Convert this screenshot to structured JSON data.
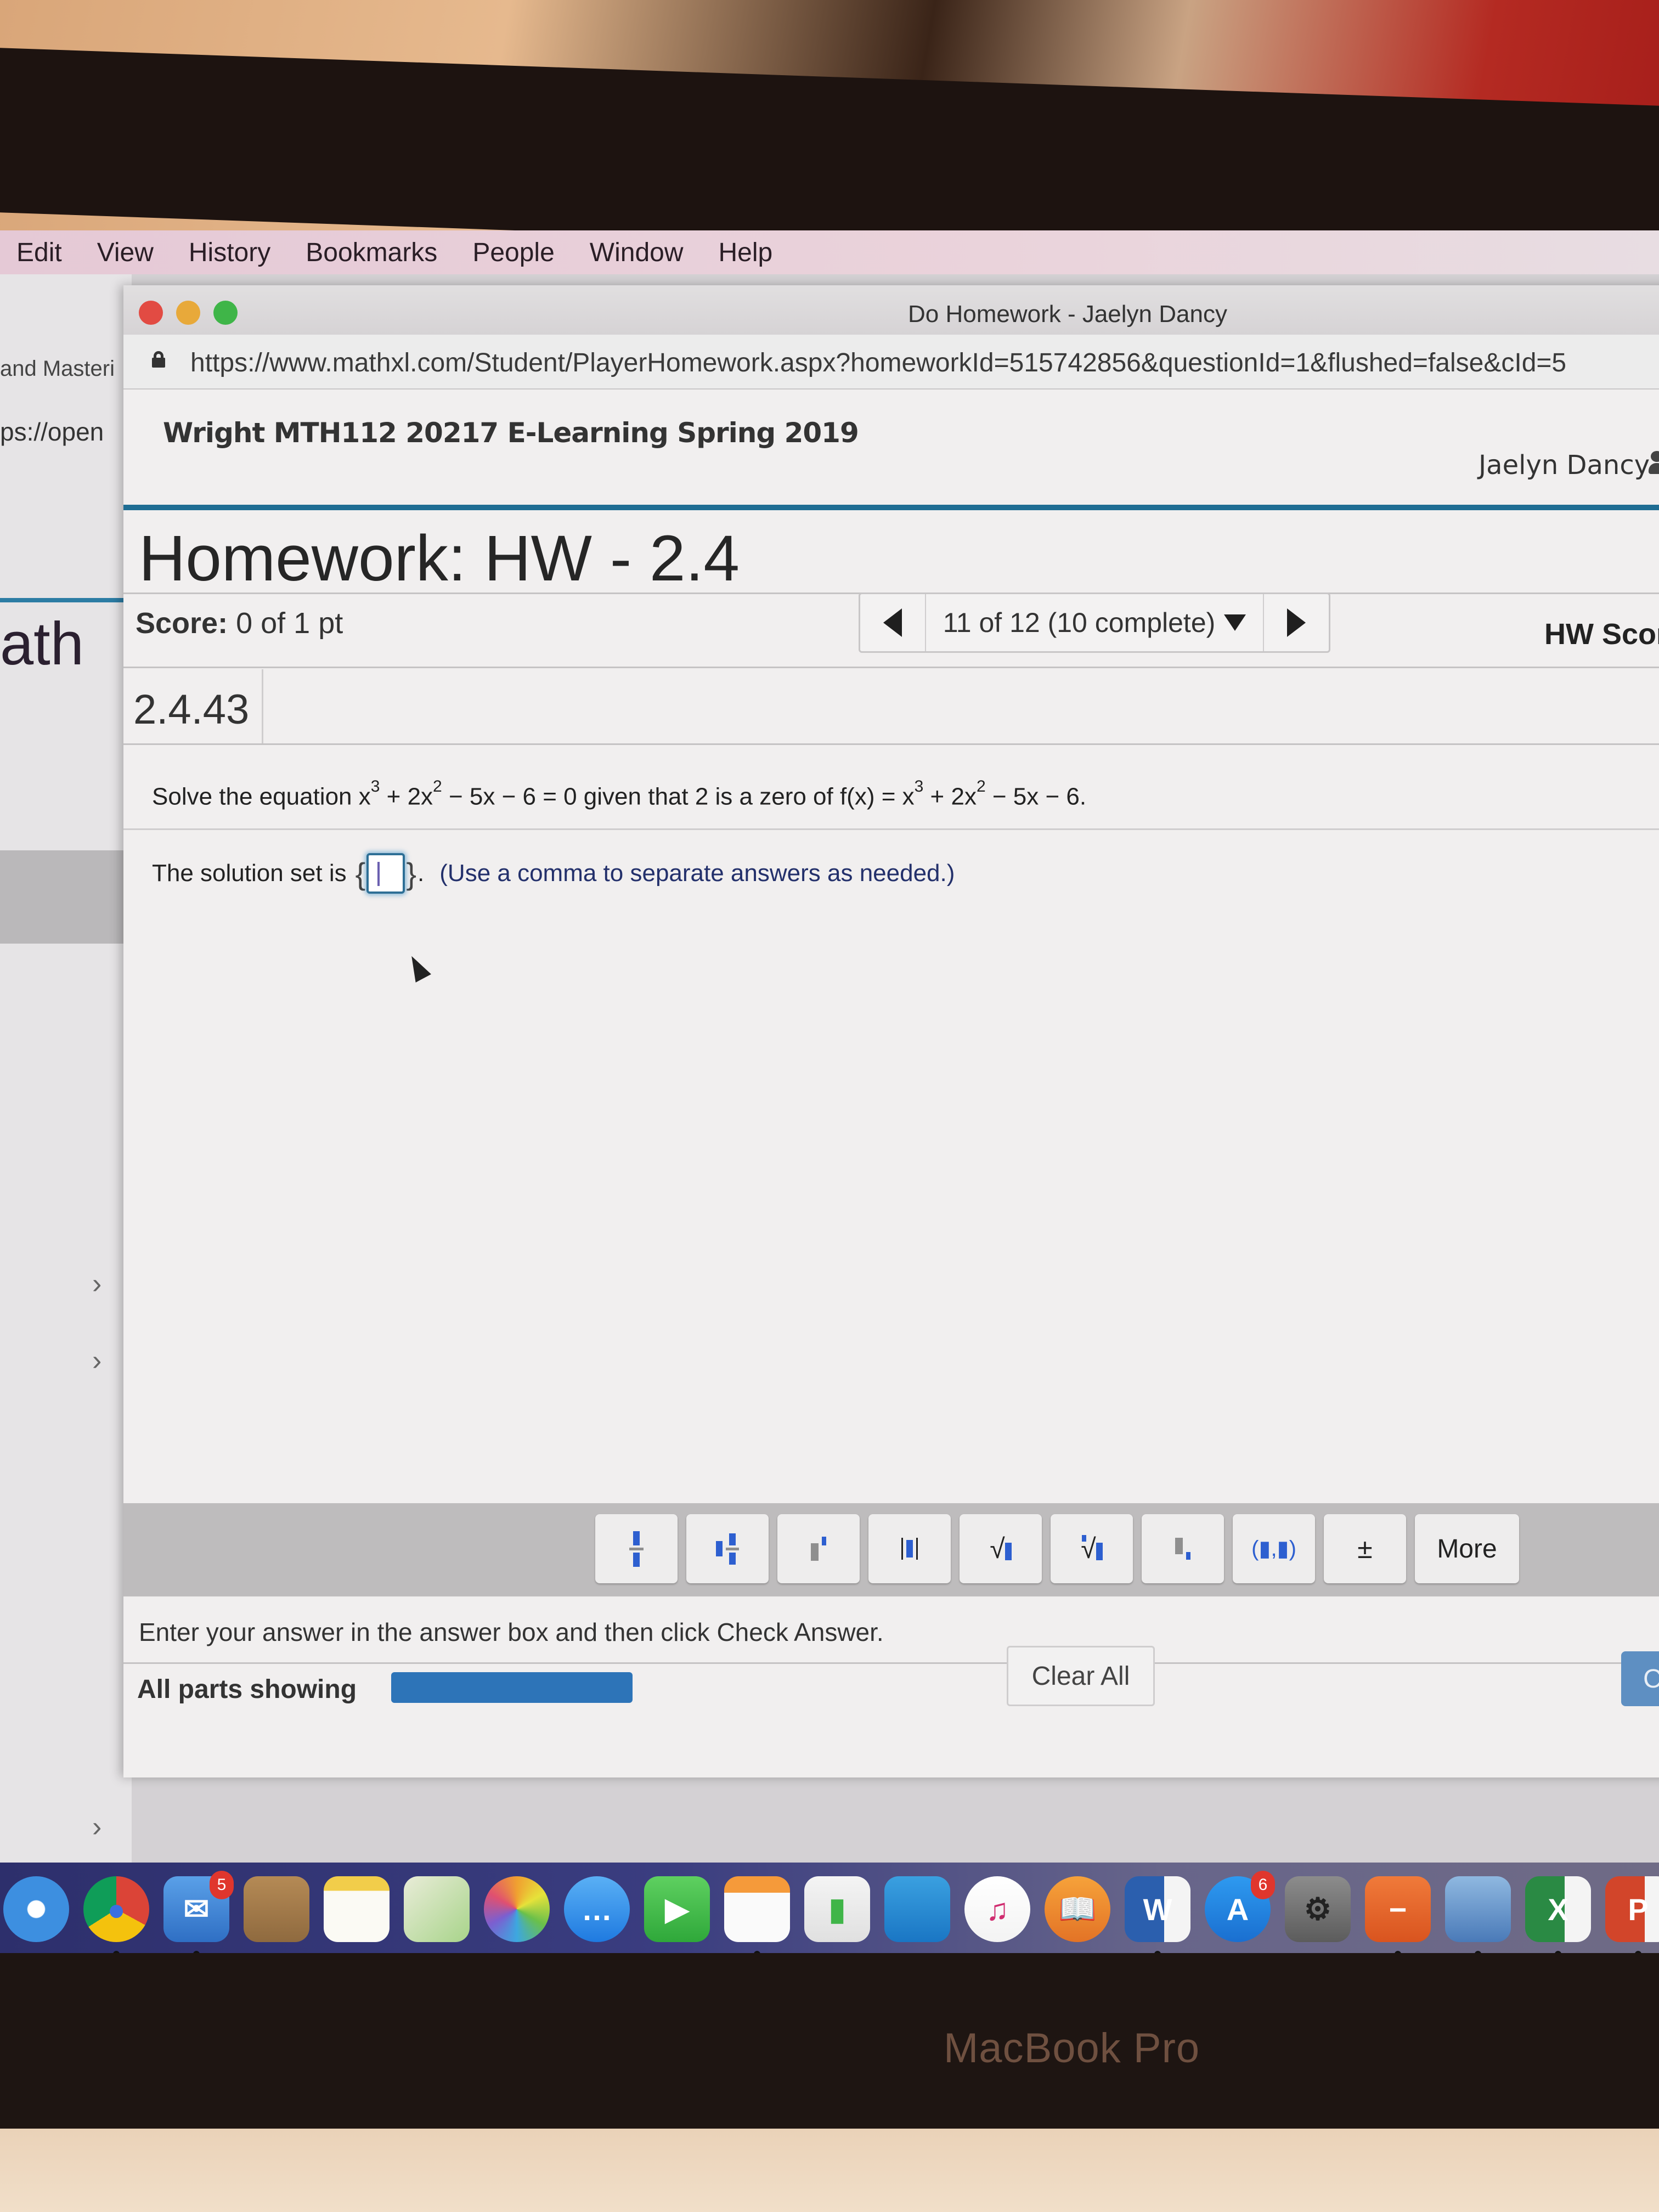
{
  "menubar": {
    "items": [
      "Edit",
      "View",
      "History",
      "Bookmarks",
      "People",
      "Window",
      "Help"
    ]
  },
  "background_window": {
    "tab_fragment": "and Masteri",
    "url_fragment": "ps://open",
    "brand_fragment": "ath"
  },
  "window": {
    "title": "Do Homework - Jaelyn Dancy",
    "url": "https://www.mathxl.com/Student/PlayerHomework.aspx?homeworkId=515742856&questionId=1&flushed=false&cId=5"
  },
  "page": {
    "course_title": "Wright MTH112 20217 E-Learning Spring 2019",
    "user_name": "Jaelyn Dancy",
    "homework_title": "Homework: HW - 2.4",
    "score_label": "Score:",
    "score_value": "0 of 1 pt",
    "question_nav": {
      "label": "11 of 12 (10 complete)",
      "current": 11,
      "total": 12,
      "complete": 10
    },
    "hw_score_label": "HW Scor",
    "question_number": "2.4.43",
    "question": {
      "prefix": "Solve the equation x",
      "exp1": "3",
      "part2": " + 2x",
      "exp2": "2",
      "part3": " − 5x − 6 = 0 given that 2 is a zero of f(x) = x",
      "exp3": "3",
      "part4": " + 2x",
      "exp4": "2",
      "part5": " − 5x − 6."
    },
    "answer": {
      "prefix": "The solution set is",
      "open_brace": "{",
      "close_brace": "}",
      "value": "",
      "suffix": ".",
      "hint": "(Use a comma to separate answers as needed.)"
    },
    "math_toolbar": {
      "buttons": [
        {
          "name": "fraction",
          "glyph": ""
        },
        {
          "name": "mixed-number",
          "glyph": ""
        },
        {
          "name": "exponent",
          "glyph": ""
        },
        {
          "name": "absolute-value",
          "glyph": ""
        },
        {
          "name": "square-root",
          "glyph": "√"
        },
        {
          "name": "nth-root",
          "glyph": "√"
        },
        {
          "name": "subscript",
          "glyph": ""
        },
        {
          "name": "ordered-pair",
          "glyph": "(▮,▮)"
        },
        {
          "name": "plus-minus",
          "glyph": "±"
        }
      ],
      "more_label": "More"
    },
    "status_message": "Enter your answer in the answer box and then click Check Answer.",
    "parts_label": "All parts showing",
    "parts_progress": 1.0,
    "clear_all_label": "Clear All",
    "check_answer_label": "C"
  },
  "dock": {
    "apps": [
      {
        "name": "safari",
        "badge": null,
        "running": false
      },
      {
        "name": "chrome",
        "badge": null,
        "running": true
      },
      {
        "name": "mail",
        "badge": "5",
        "running": true
      },
      {
        "name": "contacts",
        "badge": null,
        "running": false
      },
      {
        "name": "notes",
        "badge": null,
        "running": false
      },
      {
        "name": "maps",
        "badge": null,
        "running": false
      },
      {
        "name": "photos",
        "badge": null,
        "running": false
      },
      {
        "name": "messages",
        "badge": null,
        "running": false
      },
      {
        "name": "facetime",
        "badge": null,
        "running": false
      },
      {
        "name": "pages",
        "badge": null,
        "running": true
      },
      {
        "name": "numbers",
        "badge": null,
        "running": false
      },
      {
        "name": "keynote",
        "badge": null,
        "running": false
      },
      {
        "name": "itunes",
        "badge": null,
        "running": false
      },
      {
        "name": "ibooks",
        "badge": null,
        "running": false
      },
      {
        "name": "word",
        "badge": null,
        "running": true
      },
      {
        "name": "app-store",
        "badge": "6",
        "running": false
      },
      {
        "name": "system-preferences",
        "badge": null,
        "running": false
      },
      {
        "name": "pdf-document",
        "badge": null,
        "running": true
      },
      {
        "name": "preview",
        "badge": null,
        "running": true
      },
      {
        "name": "excel",
        "badge": null,
        "running": true
      },
      {
        "name": "powerpoint",
        "badge": null,
        "running": true
      }
    ]
  },
  "hardware_label": "MacBook Pro"
}
